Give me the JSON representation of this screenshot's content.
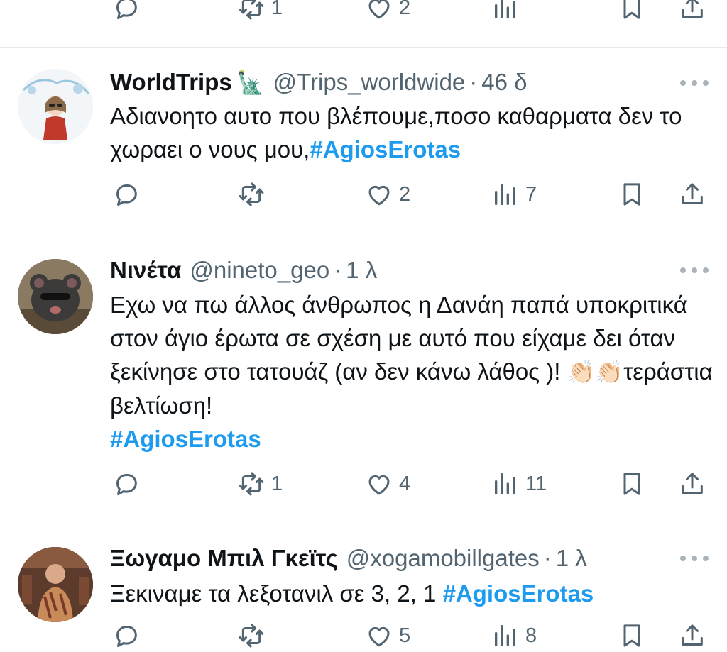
{
  "top_row": {
    "retweets": "1",
    "likes": "2"
  },
  "tweets": [
    {
      "name": "WorldTrips",
      "name_emoji": "🗽",
      "handle": "@Trips_worldwide",
      "dot": "·",
      "time": "46 δ",
      "text_before": "Αδιανοητο αυτο που βλέπουμε,ποσο καθαρματα δεν το χωραει ο νους μου,",
      "hashtag": "#AgiosErotas",
      "retweets": "",
      "likes": "2",
      "views": "7"
    },
    {
      "name": "Νινέτα",
      "handle": "@nineto_geo",
      "dot": "·",
      "time": "1 λ",
      "text_before": "Εχω να πω άλλος άνθρωπος η Δανάη παπά υποκριτικά στον άγιο έρωτα σε σχέση με αυτό που είχαμε δει όταν ξεκίνησε στο τατουάζ  (αν δεν κάνω λάθος )! ",
      "clap": "👏🏻👏🏻",
      "text_after": "τεράστια βελτίωση!",
      "hashtag": "#AgiosErotas",
      "retweets": "1",
      "likes": "4",
      "views": "11"
    },
    {
      "name": "Ξωγαμο Μπιλ Γκεϊτς",
      "handle": "@xogamobillgates",
      "dot": "·",
      "time": "1 λ",
      "text_before": "Ξεκιναμε τα λεξοτανιλ σε 3, 2, 1  ",
      "hashtag": "#AgiosErotas",
      "retweets": "",
      "likes": "5",
      "views": "8"
    }
  ],
  "colors": {
    "accent": "#1d9bf0",
    "secondary": "#536471",
    "divider": "#e6e9eb"
  },
  "icons": [
    "reply-icon",
    "retweet-icon",
    "like-icon",
    "views-icon",
    "bookmark-icon",
    "share-icon",
    "more-icon"
  ]
}
